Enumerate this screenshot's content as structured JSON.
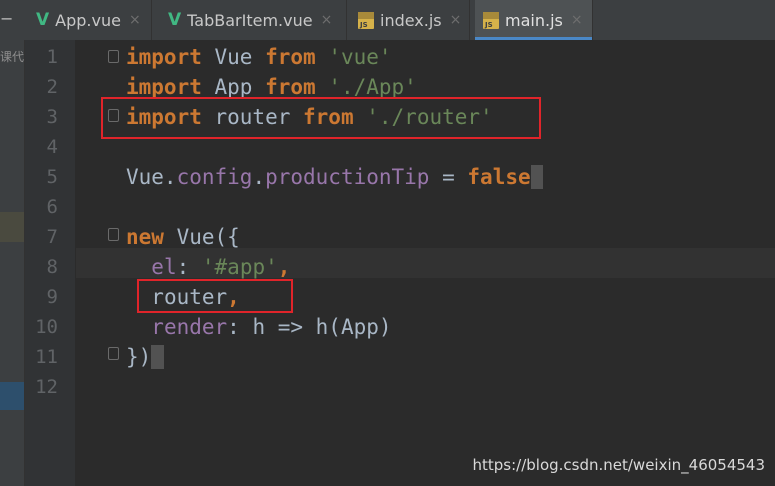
{
  "tabs": [
    {
      "label": "App.vue",
      "icon": "vue-icon",
      "close": "×"
    },
    {
      "label": "TabBarItem.vue",
      "icon": "vue-icon",
      "close": "×"
    },
    {
      "label": "index.js",
      "icon": "js-file-icon",
      "close": "×"
    },
    {
      "label": "main.js",
      "icon": "js-file-icon",
      "close": "×",
      "active": true
    }
  ],
  "icon_labels": {
    "vue": "V",
    "js": "JS"
  },
  "left_strip": {
    "dash": "−",
    "text": "课代"
  },
  "line_numbers": [
    "1",
    "2",
    "3",
    "4",
    "5",
    "6",
    "7",
    "8",
    "9",
    "10",
    "11",
    "12"
  ],
  "code": {
    "l1": {
      "kw1": "import",
      "id": " Vue ",
      "kw2": "from",
      "sp": " ",
      "str": "'vue'"
    },
    "l2": {
      "kw1": "import",
      "id": " App ",
      "kw2": "from",
      "sp": " ",
      "str": "'./App'"
    },
    "l3": {
      "kw1": "import",
      "id": " router ",
      "kw2": "from",
      "sp": " ",
      "str": "'./router'"
    },
    "l5": {
      "a": "Vue.",
      "b": "config",
      "c": ".",
      "d": "productionTip",
      "e": " = ",
      "f": "false",
      "caret": " "
    },
    "l7": {
      "kw": "new",
      "rest": " Vue({"
    },
    "l8": {
      "indent": "  ",
      "prop": "el",
      "colon": ": ",
      "str": "'#app'",
      "comma": ","
    },
    "l9": {
      "indent": "  ",
      "id": "router",
      "comma": ","
    },
    "l10": {
      "indent": "  ",
      "prop": "render",
      "rest": ": h => h(App)"
    },
    "l11": {
      "text": "})",
      "caret": " "
    }
  },
  "colors": {
    "keyword": "#cc7832",
    "string": "#6a8759",
    "property": "#9876aa",
    "highlight_box": "#e0242a"
  },
  "watermark": "https://blog.csdn.net/weixin_46054543"
}
